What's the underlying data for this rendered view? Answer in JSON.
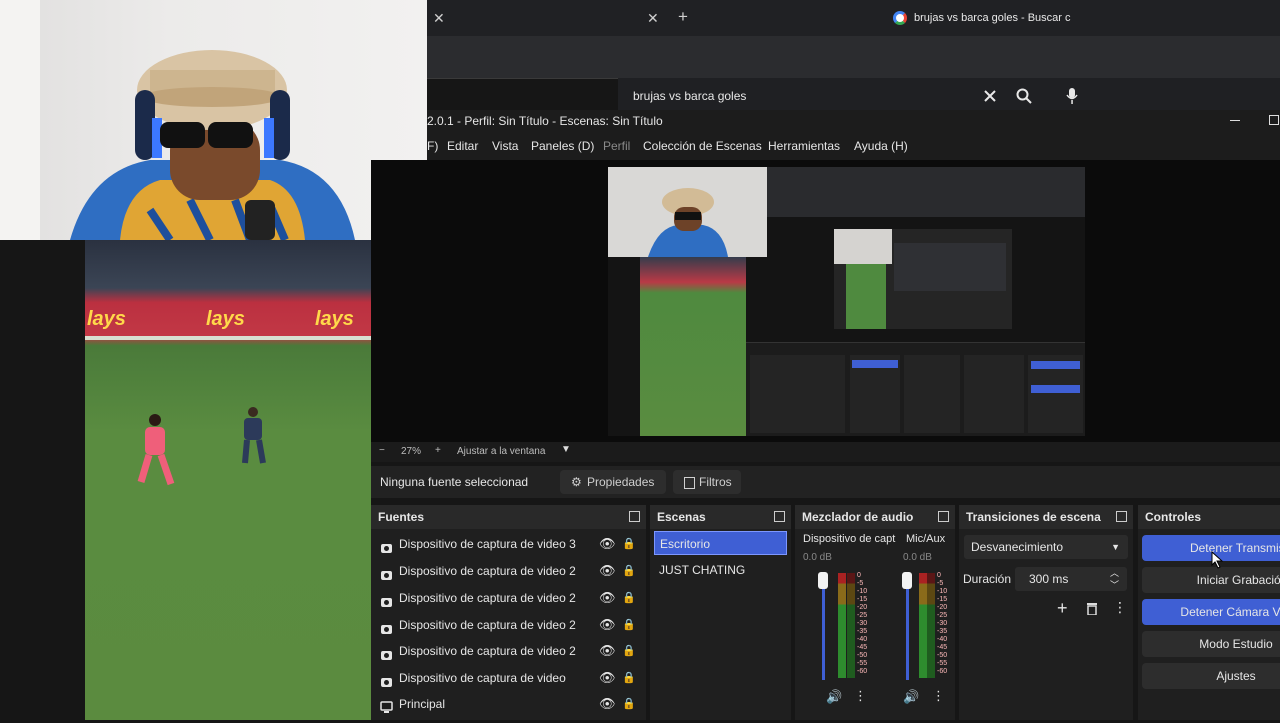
{
  "browser": {
    "tab_label": "brujas vs barca goles - Buscar c",
    "new_tab": "+",
    "close": "✕",
    "search_query": "brujas vs barca goles"
  },
  "obs": {
    "title": "2.0.1 - Perfil: Sin Título - Escenas: Sin Título",
    "menu": [
      "F)",
      "Editar",
      "Vista",
      "Paneles (D)",
      "Perfil",
      "Colección de Escenas",
      "Herramientas",
      "Ayuda (H)"
    ],
    "zoom": {
      "minus": "−",
      "value": "27%",
      "plus": "+",
      "fit": "Ajustar a la ventana"
    },
    "source_toolbar": {
      "status": "Ninguna fuente seleccionad",
      "properties": "Propiedades",
      "filters": "Filtros"
    },
    "sources": {
      "title": "Fuentes",
      "items": [
        {
          "label": "Dispositivo de captura de video 3",
          "icon": "camera-icon"
        },
        {
          "label": "Dispositivo de captura de video 2",
          "icon": "camera-icon"
        },
        {
          "label": "Dispositivo de captura de video 2",
          "icon": "camera-icon"
        },
        {
          "label": "Dispositivo de captura de video 2",
          "icon": "camera-icon"
        },
        {
          "label": "Dispositivo de captura de video 2",
          "icon": "camera-icon"
        },
        {
          "label": "Dispositivo de captura de video",
          "icon": "camera-icon"
        },
        {
          "label": "Principal",
          "icon": "monitor-icon"
        }
      ]
    },
    "scenes": {
      "title": "Escenas",
      "items": [
        "Escritorio",
        "JUST CHATING"
      ],
      "selected": 0
    },
    "mixer": {
      "title": "Mezclador de audio",
      "channels": [
        {
          "name": "Dispositivo de capt",
          "db": "0.0 dB",
          "volume": 1.0
        },
        {
          "name": "Mic/Aux",
          "db": "0.0 dB",
          "volume": 1.0
        }
      ],
      "scale": [
        "0",
        "-5",
        "-10",
        "-15",
        "-20",
        "-25",
        "-30",
        "-35",
        "-40",
        "-45",
        "-50",
        "-55",
        "-60"
      ]
    },
    "transitions": {
      "title": "Transiciones de escena",
      "type": "Desvanecimiento",
      "duration_label": "Duración",
      "duration_value": "300 ms"
    },
    "controls": {
      "title": "Controles",
      "buttons": [
        {
          "label": "Detener Transmisió",
          "active": true
        },
        {
          "label": "Iniciar Grabación",
          "active": false
        },
        {
          "label": "Detener Cámara Virtua",
          "active": true
        },
        {
          "label": "Modo Estudio",
          "active": false
        },
        {
          "label": "Ajustes",
          "active": false
        }
      ]
    },
    "colors": {
      "accent": "#3f5fd4",
      "panel": "#1f1f1f",
      "header": "#292929"
    }
  },
  "feed": {
    "ad_text": "lays"
  }
}
